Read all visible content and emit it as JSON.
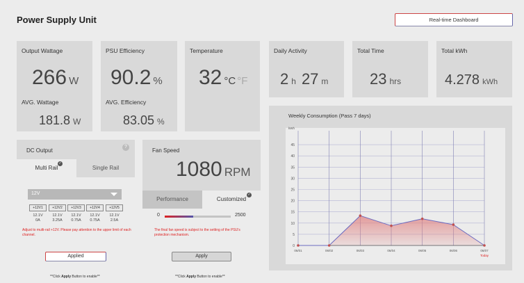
{
  "header": {
    "title": "Power Supply Unit",
    "dashboard_button": "Real-time Dashboard"
  },
  "output": {
    "title": "Output Wattage",
    "value": "266",
    "unit": "W",
    "avg_title": "AVG. Wattage",
    "avg_value": "181.8",
    "avg_unit": "W"
  },
  "efficiency": {
    "title": "PSU Efficiency",
    "value": "90.2",
    "unit": "%",
    "avg_title": "AVG. Efficiency",
    "avg_value": "83.05",
    "avg_unit": "%"
  },
  "temperature": {
    "title": "Temperature",
    "value": "32",
    "unit_c": "°C",
    "unit_f": "°F"
  },
  "daily": {
    "title": "Daily Activity",
    "hours": "2",
    "hours_unit": "h",
    "minutes": "27",
    "minutes_unit": "m"
  },
  "total_time": {
    "title": "Total Time",
    "value": "23",
    "unit": "hrs"
  },
  "total_kwh": {
    "title": "Total kWh",
    "value": "4.278",
    "unit": "kWh"
  },
  "dc_output": {
    "title": "DC Output",
    "tabs": [
      "Multi Rail",
      "Single Rail"
    ],
    "active_tab": "Multi Rail",
    "select_value": "12V",
    "rails": [
      {
        "label": "+12V1",
        "volt": "12.1V",
        "amp": "0A"
      },
      {
        "label": "+12V2",
        "volt": "12.1V",
        "amp": "3.25A"
      },
      {
        "label": "+12V3",
        "volt": "12.1V",
        "amp": "0.75A"
      },
      {
        "label": "+12V4",
        "volt": "12.1V",
        "amp": "0.75A"
      },
      {
        "label": "+12V5",
        "volt": "12.1V",
        "amp": "2.5A"
      }
    ],
    "warning": "Adjust to multi-rail +12V. Please pay attention to the upper limit of each channel.",
    "button": "Applied",
    "note_pre": "**Click ",
    "note_bold": "Apply",
    "note_post": " Button to enable**"
  },
  "fan": {
    "title": "Fan Speed",
    "value": "1080",
    "unit": "RPM",
    "tabs": [
      "Performance",
      "Customized"
    ],
    "active_tab": "Performance",
    "slider_min": "0",
    "slider_max": "2500",
    "slider_value": 1080,
    "warning": "The final fan speed is subject to the setting of the PSU's protection mechanism.",
    "button": "Apply",
    "note_pre": "**Click ",
    "note_bold": "Apply",
    "note_post": " Button to enable**"
  },
  "colors": {
    "accent_red": "#d22222",
    "accent_blue": "#5050a0",
    "line": "#6b6bc0"
  },
  "chart_data": {
    "type": "area",
    "title": "Weekly Consumption (Pass 7 days)",
    "ylabel": "kWh",
    "x": [
      "06/01",
      "06/02",
      "06/03",
      "06/04",
      "06/05",
      "06/06",
      "06/07"
    ],
    "x_extra_label": "Today",
    "values": [
      0,
      0,
      13.3,
      8.8,
      11.9,
      9.3,
      0
    ],
    "ylim": [
      0,
      50
    ],
    "yticks": [
      0,
      5,
      10,
      15,
      20,
      25,
      30,
      35,
      40,
      45
    ],
    "grid": true
  }
}
